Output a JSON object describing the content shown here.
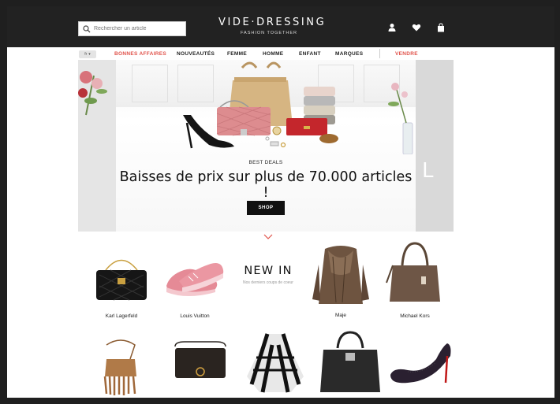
{
  "search": {
    "placeholder": "Rechercher un article"
  },
  "logo": {
    "name": "VIDE·DRESSING",
    "tagline": "FASHION TOGETHER"
  },
  "header_icons": [
    "user-icon",
    "heart-icon",
    "bag-icon"
  ],
  "lang": {
    "label": "fr"
  },
  "nav": [
    {
      "label": "BONNES AFFAIRES",
      "color": "#e0524a"
    },
    {
      "label": "NOUVEAUTÉS"
    },
    {
      "label": "FEMME"
    },
    {
      "label": "HOMME"
    },
    {
      "label": "ENFANT"
    },
    {
      "label": "MARQUES"
    },
    {
      "label": "VENDRE",
      "color": "#e0524a"
    }
  ],
  "hero": {
    "eyebrow": "BEST DEALS",
    "headline": "Baisses de prix sur plus de 70.000 articles !",
    "button": "SHOP",
    "next_slide_letter": "L"
  },
  "new_in": {
    "title": "NEW IN",
    "subtitle": "Nos derniers coups de coeur"
  },
  "products": [
    {
      "brand": "Karl Lagerfeld",
      "item": "quilted-bag"
    },
    {
      "brand": "Louis Vuitton",
      "item": "sneakers"
    },
    {
      "brand": "Maje",
      "item": "fur-coat"
    },
    {
      "brand": "Michael Kors",
      "item": "tote-bag"
    },
    {
      "item": "fringe-bag"
    },
    {
      "item": "crossbody-bag"
    },
    {
      "item": "poncho"
    },
    {
      "item": "black-tote"
    },
    {
      "item": "stiletto-pump"
    }
  ]
}
